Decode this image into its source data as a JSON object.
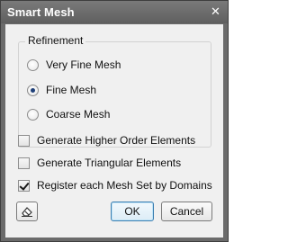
{
  "window": {
    "title": "Smart Mesh",
    "close_glyph": "✕"
  },
  "refinement": {
    "legend": "Refinement",
    "options": [
      {
        "label": "Very Fine Mesh",
        "selected": false
      },
      {
        "label": "Fine Mesh",
        "selected": true
      },
      {
        "label": "Coarse Mesh",
        "selected": false
      }
    ]
  },
  "options": {
    "higher_order": {
      "label": "Generate Higher Order Elements",
      "checked": false
    },
    "triangular": {
      "label": "Generate Triangular Elements",
      "checked": false
    },
    "register_domains": {
      "label": "Register each Mesh Set by Domains",
      "checked": true
    }
  },
  "buttons": {
    "clear_icon": "eraser-icon",
    "ok_label": "OK",
    "cancel_label": "Cancel"
  },
  "colors": {
    "titlebar": "#6b6b6b",
    "client": "#f0f0f0",
    "radio_dot": "#1f3f78",
    "default_button_border": "#3c7fb1"
  }
}
